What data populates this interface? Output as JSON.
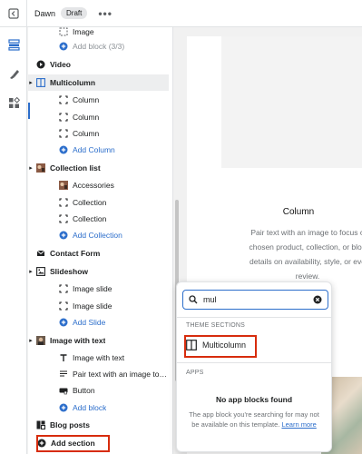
{
  "topbar": {
    "theme_name": "Dawn",
    "status_badge": "Draft",
    "more": "•••"
  },
  "rail": {
    "items": [
      "sections-icon",
      "theme-settings-icon",
      "apps-icon"
    ]
  },
  "sidebar": {
    "rows": [
      {
        "label": "Image",
        "kind": "block",
        "icon": "image-block-icon"
      },
      {
        "label": "Add block (3/3)",
        "kind": "muted",
        "icon": "add-circle-icon"
      },
      {
        "label": "Video",
        "kind": "section",
        "icon": "play-icon"
      },
      {
        "label": "Multicolumn",
        "kind": "section-selected",
        "icon": "columns-icon"
      },
      {
        "label": "Column",
        "kind": "block",
        "icon": "block-icon"
      },
      {
        "label": "Column",
        "kind": "block",
        "icon": "block-icon"
      },
      {
        "label": "Column",
        "kind": "block",
        "icon": "block-icon"
      },
      {
        "label": "Add Column",
        "kind": "add",
        "icon": "add-circle-icon"
      },
      {
        "label": "Collection list",
        "kind": "section",
        "icon": "collection-thumb-icon"
      },
      {
        "label": "Accessories",
        "kind": "block",
        "icon": "collection-thumb-icon"
      },
      {
        "label": "Collection",
        "kind": "block",
        "icon": "block-icon"
      },
      {
        "label": "Collection",
        "kind": "block",
        "icon": "block-icon"
      },
      {
        "label": "Add Collection",
        "kind": "add",
        "icon": "add-circle-icon"
      },
      {
        "label": "Contact Form",
        "kind": "section",
        "icon": "form-icon"
      },
      {
        "label": "Slideshow",
        "kind": "section",
        "icon": "slideshow-icon"
      },
      {
        "label": "Image slide",
        "kind": "block",
        "icon": "block-icon"
      },
      {
        "label": "Image slide",
        "kind": "block",
        "icon": "block-icon"
      },
      {
        "label": "Add Slide",
        "kind": "add",
        "icon": "add-circle-icon"
      },
      {
        "label": "Image with text",
        "kind": "section",
        "icon": "image-thumb-icon"
      },
      {
        "label": "Image with text",
        "kind": "block",
        "icon": "text-icon"
      },
      {
        "label": "Pair text with an image to f...",
        "kind": "block",
        "icon": "paragraph-icon"
      },
      {
        "label": "Button",
        "kind": "block",
        "icon": "button-block-icon"
      },
      {
        "label": "Add block",
        "kind": "add",
        "icon": "add-circle-icon"
      },
      {
        "label": "Blog posts",
        "kind": "section",
        "icon": "blog-icon"
      },
      {
        "label": "Add section",
        "kind": "add-section",
        "icon": "add-circle-filled-icon"
      }
    ]
  },
  "preview": {
    "column_title": "Column",
    "column_text": [
      "Pair text with an image to focus o",
      "chosen product, collection, or blog",
      "details on availability, style, or eve",
      "review."
    ]
  },
  "popup": {
    "search_value": "mul",
    "theme_sections_heading": "THEME SECTIONS",
    "result_label": "Multicolumn",
    "apps_heading": "APPS",
    "empty_title": "No app blocks found",
    "empty_text": "The app block you're searching for may not be available on this template.",
    "learn_more": "Learn more"
  },
  "colors": {
    "accent": "#2c6ecb",
    "highlight": "#d72c0d"
  }
}
